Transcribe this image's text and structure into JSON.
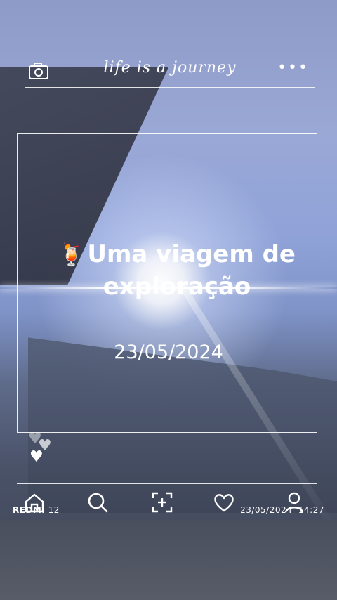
{
  "header": {
    "title": "life is a journey",
    "icons": {
      "left": "camera-icon",
      "right": "more-dots-icon"
    },
    "more_glyph": "•••"
  },
  "post": {
    "headline_emoji": "🍹",
    "headline": "Uma viagem de exploração",
    "date": "23/05/2024"
  },
  "hearts": [
    "♥",
    "♥",
    "♥"
  ],
  "nav": {
    "items": [
      "home-icon",
      "search-icon",
      "add-photo-icon",
      "heart-icon",
      "profile-icon"
    ]
  },
  "watermark": {
    "brand": "REDMI",
    "model": " 12",
    "date": "23/05/2024",
    "time": "14:27"
  },
  "colors": {
    "accent": "#ffffff",
    "sky": "#8fa2d8"
  }
}
